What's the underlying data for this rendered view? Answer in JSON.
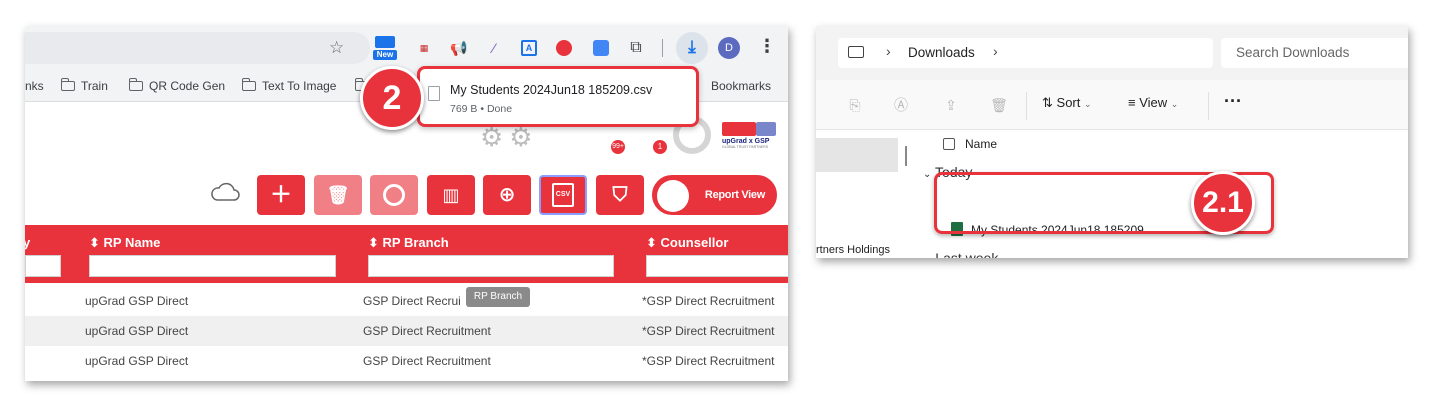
{
  "colors": {
    "accent": "#e8323c",
    "accent_dim": "#f07f86",
    "chrome_bg": "#f1f3f4"
  },
  "browser": {
    "profile_initial": "D",
    "new_badge": "New",
    "bookmarks": [
      "nks",
      "Train",
      "QR Code Gen",
      "Text To Image"
    ],
    "bookmarks_right": "Bookmarks",
    "notif_count_1": "99+",
    "notif_count_2": "1"
  },
  "download_popup": {
    "file_name": "My Students 2024Jun18 185209.csv",
    "meta": "769 B • Done",
    "step_label": "2"
  },
  "app": {
    "logo_text": "upGrad x GSP",
    "logo_sub": "GLOBAL TRUST PARTNERS",
    "toolbar_icons": [
      "add-icon",
      "delete-icon",
      "user-icon",
      "columns-icon",
      "zoom-icon",
      "csv-icon",
      "filter-clear-icon"
    ],
    "csv_label": "CSV",
    "report_view_label": "Report View",
    "columns": [
      "RP Name",
      "RP Branch",
      "Counsellor"
    ],
    "tooltip": "RP Branch",
    "rows": [
      [
        "upGrad GSP Direct",
        "GSP Direct Recrui",
        "*GSP Direct Recruitment"
      ],
      [
        "upGrad GSP Direct",
        "GSP Direct Recruitment",
        "*GSP Direct Recruitment"
      ],
      [
        "upGrad GSP Direct",
        "GSP Direct Recruitment",
        "*GSP Direct Recruitment"
      ]
    ]
  },
  "explorer": {
    "breadcrumb": "Downloads",
    "search_placeholder": "Search Downloads",
    "sort_label": "Sort",
    "view_label": "View",
    "more_label": "···",
    "name_header": "Name",
    "group_today": "Today",
    "file_name": "My Students 2024Jun18 185209",
    "group_last_week": "Last week",
    "nav_item": "rtners Holdings",
    "step_label": "2.1"
  }
}
